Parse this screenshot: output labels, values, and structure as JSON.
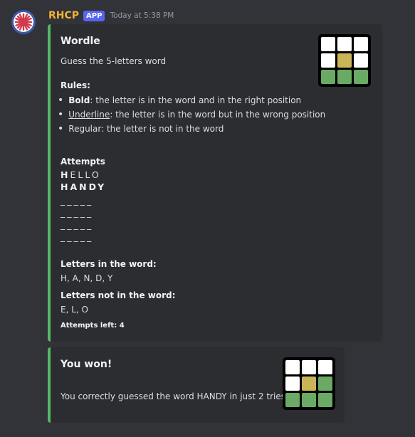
{
  "message": {
    "username": "RHCP",
    "badge": "APP",
    "timestamp": "Today at 5:38 PM"
  },
  "embed1": {
    "title": "Wordle",
    "subtitle": "Guess the 5-letters word",
    "rules_heading": "Rules:",
    "rules": [
      {
        "term": "Bold",
        "desc": ": the letter is in the word and in the right position"
      },
      {
        "term": "Underline",
        "desc": ": the letter is in the word but in the wrong position"
      },
      {
        "term": "",
        "desc": "Regular: the letter is not in the word"
      }
    ],
    "attempts_heading": "Attempts",
    "attempts": [
      {
        "bold": "H",
        "rest": "ELLO"
      },
      {
        "bold": "HANDY",
        "rest": ""
      },
      {
        "bold": "",
        "rest": "_____"
      },
      {
        "bold": "",
        "rest": "_____"
      },
      {
        "bold": "",
        "rest": "_____"
      },
      {
        "bold": "",
        "rest": "_____"
      }
    ],
    "letters_in_heading": "Letters in the word:",
    "letters_in": "H, A, N, D, Y",
    "letters_not_heading": "Letters not in the word:",
    "letters_not": "E, L, O",
    "attempts_left": "Attempts left: 4",
    "thumbnail_icon": "wordle-grid-icon"
  },
  "embed2": {
    "title": "You won!",
    "text": "You correctly guessed the word HANDY in just 2 tries",
    "thumbnail_icon": "wordle-grid-icon"
  },
  "colors": {
    "background": "#313338",
    "embed_background": "#2b2d31",
    "embed_accent": "#57b868",
    "username": "#f0b232",
    "badge": "#5865f2",
    "tile_yellow": "#c9b458",
    "tile_green": "#6aaa64"
  }
}
